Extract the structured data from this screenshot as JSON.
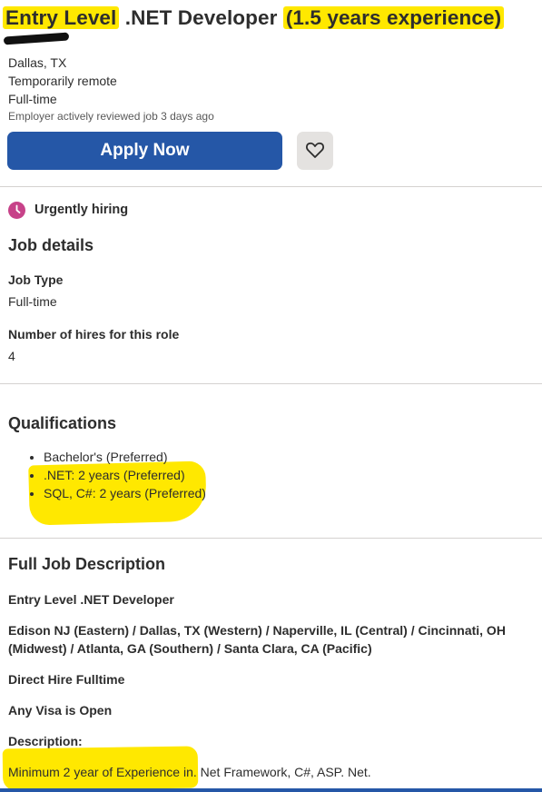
{
  "job": {
    "title_hl1": "Entry Level",
    "title_mid": " .NET Developer ",
    "title_hl2": "(1.5 years experience)",
    "location": "Dallas, TX",
    "remote": "Temporarily remote",
    "employment_type": "Full-time",
    "activity": "Employer actively reviewed job 3 days ago"
  },
  "actions": {
    "apply_label": "Apply Now",
    "save_icon": "heart-icon"
  },
  "badges": {
    "urgent_label": "Urgently hiring",
    "urgent_icon": "clock-icon"
  },
  "details": {
    "heading": "Job details",
    "job_type_label": "Job Type",
    "job_type_value": "Full-time",
    "hires_label": "Number of hires for this role",
    "hires_value": "4"
  },
  "qualifications": {
    "heading": "Qualifications",
    "items": [
      "Bachelor's (Preferred)",
      ".NET: 2 years (Preferred)",
      "SQL, C#: 2 years (Preferred)"
    ]
  },
  "description": {
    "heading": "Full Job Description",
    "line1": "Entry Level .NET Developer",
    "line2": "Edison NJ (Eastern) / Dallas, TX (Western) / Naperville, IL (Central) / Cincinnati, OH (Midwest) / Atlanta, GA (Southern) / Santa Clara, CA (Pacific)",
    "line3": "Direct Hire Fulltime",
    "line4": "Any Visa is Open",
    "line5": "Description:",
    "line6": "Minimum 2 year of Experience in. Net Framework, C#, ASP. Net."
  },
  "colors": {
    "accent": "#2557a7",
    "highlight": "#ffe800",
    "urgent_icon": "#c74289"
  }
}
